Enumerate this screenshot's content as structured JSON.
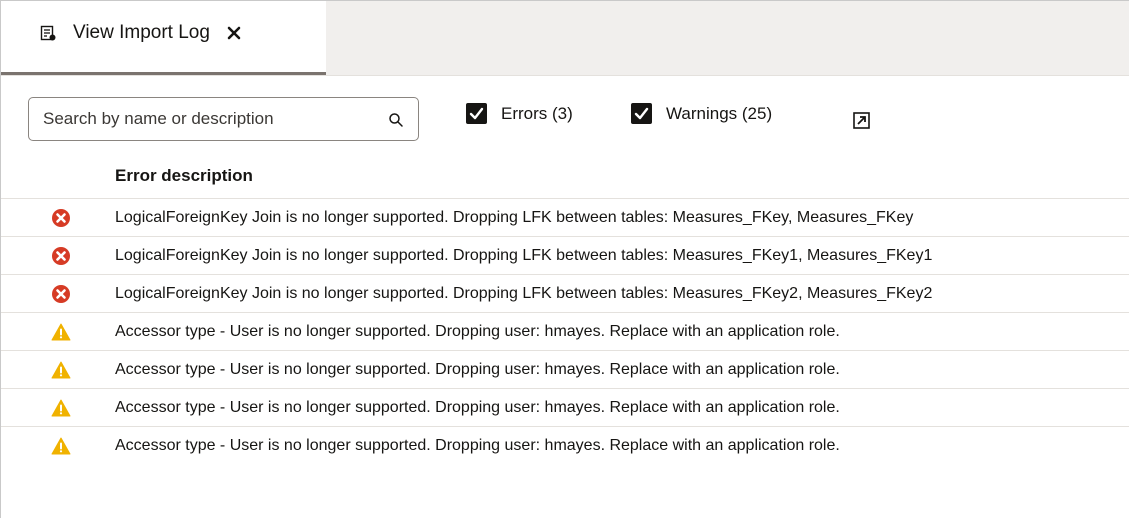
{
  "tab": {
    "label": "View Import Log",
    "icon": "log-icon",
    "close_icon": "close-icon"
  },
  "toolbar": {
    "search": {
      "placeholder": "Search by name or description",
      "value": "",
      "icon": "search-icon"
    },
    "errors_filter": {
      "label": "Errors (3)",
      "checked": true
    },
    "warnings_filter": {
      "label": "Warnings (25)",
      "checked": true
    },
    "popout_icon": "popout-icon"
  },
  "table": {
    "header": "Error description",
    "rows": [
      {
        "severity": "error",
        "icon": "error-icon",
        "text": "LogicalForeignKey Join is no longer supported. Dropping LFK between tables: Measures_FKey, Measures_FKey"
      },
      {
        "severity": "error",
        "icon": "error-icon",
        "text": "LogicalForeignKey Join is no longer supported. Dropping LFK between tables: Measures_FKey1, Measures_FKey1"
      },
      {
        "severity": "error",
        "icon": "error-icon",
        "text": "LogicalForeignKey Join is no longer supported. Dropping LFK between tables: Measures_FKey2, Measures_FKey2"
      },
      {
        "severity": "warning",
        "icon": "warning-icon",
        "text": "Accessor type - User is no longer supported. Dropping user: hmayes. Replace with an application role."
      },
      {
        "severity": "warning",
        "icon": "warning-icon",
        "text": "Accessor type - User is no longer supported. Dropping user: hmayes. Replace with an application role."
      },
      {
        "severity": "warning",
        "icon": "warning-icon",
        "text": "Accessor type - User is no longer supported. Dropping user: hmayes. Replace with an application role."
      },
      {
        "severity": "warning",
        "icon": "warning-icon",
        "text": "Accessor type - User is no longer supported. Dropping user: hmayes. Replace with an application role."
      }
    ]
  },
  "colors": {
    "error": "#d63b25",
    "warning": "#f0b200",
    "checkbox": "#161513",
    "tab_underline": "#7a736e"
  }
}
